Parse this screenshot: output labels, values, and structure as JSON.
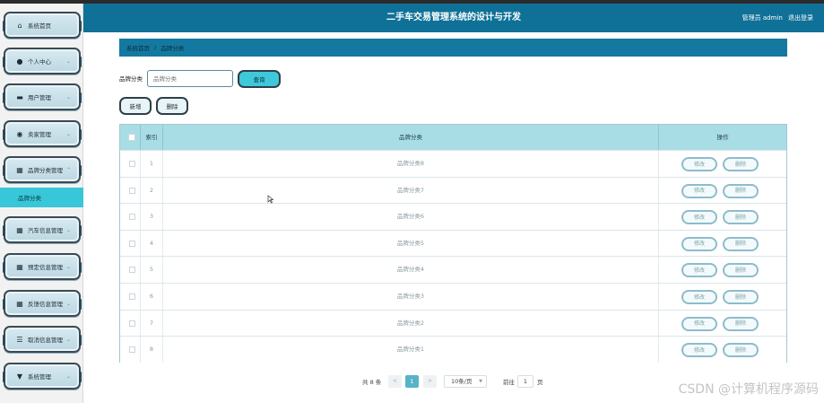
{
  "header": {
    "title": "二手车交易管理系统的设计与开发",
    "user": "管理员 admin",
    "logout": "退出登录"
  },
  "sidebar": {
    "items": [
      {
        "label": "系统首页",
        "icon": "home-icon",
        "glyph": "⌂"
      },
      {
        "label": "个人中心",
        "icon": "user-icon",
        "glyph": "●"
      },
      {
        "label": "用户管理",
        "icon": "users-card-icon",
        "glyph": "▬"
      },
      {
        "label": "卖家管理",
        "icon": "location-icon",
        "glyph": "◉"
      },
      {
        "label": "品牌分类管理",
        "icon": "grid-icon",
        "glyph": "▦"
      },
      {
        "label": "汽车信息管理",
        "icon": "grid-icon",
        "glyph": "▦"
      },
      {
        "label": "预定信息管理",
        "icon": "grid-icon",
        "glyph": "▦"
      },
      {
        "label": "反馈信息管理",
        "icon": "grid-icon",
        "glyph": "▦"
      },
      {
        "label": "取消信息管理",
        "icon": "list-icon",
        "glyph": "☰"
      },
      {
        "label": "系统管理",
        "icon": "trophy-icon",
        "glyph": "▼"
      }
    ],
    "active_sub": "品牌分类"
  },
  "breadcrumb": {
    "home": "系统首页",
    "sep": "/",
    "current": "品牌分类"
  },
  "search": {
    "label": "品牌分类",
    "placeholder": "品牌分类",
    "button": "查询"
  },
  "actions": {
    "add": "新增",
    "delete": "删除"
  },
  "table": {
    "headers": {
      "index": "索引",
      "category": "品牌分类",
      "ops": "操作"
    },
    "edit_label": "修改",
    "delete_label": "删除",
    "rows": [
      {
        "index": "1",
        "category": "品牌分类8"
      },
      {
        "index": "2",
        "category": "品牌分类7"
      },
      {
        "index": "3",
        "category": "品牌分类6"
      },
      {
        "index": "4",
        "category": "品牌分类5"
      },
      {
        "index": "5",
        "category": "品牌分类4"
      },
      {
        "index": "6",
        "category": "品牌分类3"
      },
      {
        "index": "7",
        "category": "品牌分类2"
      },
      {
        "index": "8",
        "category": "品牌分类1"
      }
    ]
  },
  "pagination": {
    "total": "共 8 条",
    "prev": "<",
    "current": "1",
    "next": ">",
    "page_size": "10条/页",
    "goto_label": "前往",
    "goto_value": "1",
    "page_unit": "页"
  },
  "watermark": "CSDN @计算机程序源码"
}
